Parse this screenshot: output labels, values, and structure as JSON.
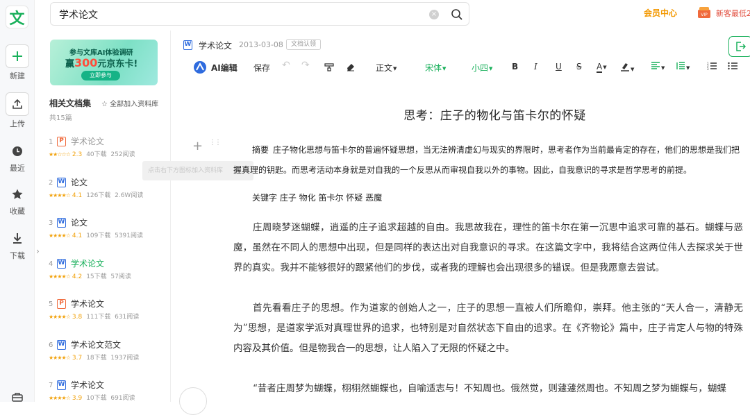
{
  "app": {
    "logo_char": "文"
  },
  "rail": {
    "new": "新建",
    "upload": "上传",
    "recent": "最近",
    "favorites": "收藏",
    "download": "下载"
  },
  "search": {
    "value": "学术论文"
  },
  "header": {
    "member_center": "会员中心",
    "newbie": "新客最低2"
  },
  "banner": {
    "line1": "参与文库AI体验调研",
    "line2_pre": "赢",
    "line2_num": "300",
    "line2_post": "元京东卡!",
    "button": "立即参与"
  },
  "related": {
    "title": "相关文档集",
    "add_all": "全部加入资料库",
    "count": "共15篇",
    "tooltip": "点击右下方图标加入资料库",
    "items": [
      {
        "num": "1",
        "type": "P",
        "name": "学术论文",
        "stars": "★★☆☆☆",
        "score": "2.3",
        "downloads": "40下载",
        "reads": "252阅读",
        "state": "gray"
      },
      {
        "num": "2",
        "type": "W",
        "name": "论文",
        "stars": "★★★★☆",
        "score": "4.1",
        "downloads": "126下载",
        "reads": "2.6W阅读",
        "state": "normal"
      },
      {
        "num": "3",
        "type": "W",
        "name": "论文",
        "stars": "★★★★☆",
        "score": "4.1",
        "downloads": "109下载",
        "reads": "5391阅读",
        "state": "normal"
      },
      {
        "num": "4",
        "type": "W",
        "name": "学术论文",
        "stars": "★★★★☆",
        "score": "4.2",
        "downloads": "15下载",
        "reads": "57阅读",
        "state": "active"
      },
      {
        "num": "5",
        "type": "P",
        "name": "学术论文",
        "stars": "★★★★☆",
        "score": "3.8",
        "downloads": "111下载",
        "reads": "631阅读",
        "state": "normal"
      },
      {
        "num": "6",
        "type": "W",
        "name": "学术论文范文",
        "stars": "★★★★☆",
        "score": "3.7",
        "downloads": "18下载",
        "reads": "1937阅读",
        "state": "normal"
      },
      {
        "num": "7",
        "type": "W",
        "name": "学术论文",
        "stars": "★★★★☆",
        "score": "3.9",
        "downloads": "10下载",
        "reads": "691阅读",
        "state": "normal"
      }
    ]
  },
  "doc": {
    "title": "学术论文",
    "date": "2013-03-08",
    "badge": "文档认领"
  },
  "toolbar": {
    "ai_edit": "AI编辑",
    "save": "保存",
    "style": "正文",
    "font": "宋体",
    "size": "小四"
  },
  "content": {
    "heading": "思考：庄子的物化与笛卡尔的怀疑",
    "abstract_label": "摘要",
    "abstract_text": "庄子物化思想与笛卡尔的普遍怀疑思想，当无法辨清虚幻与现实的界限时，思考者作为当前最肯定的存在，他们的思想是我们把握真理的钥匙。而思考活动本身就是对自我的一个反思从而审视自我以外的事物。因此，自我意识的寻求是哲学思考的前提。",
    "keywords": "关键字 庄子 物化 笛卡尔 怀疑 恶魔",
    "para1": "庄周晓梦迷蝴蝶，逍遥的庄子追求超越的自由。我思故我在，理性的笛卡尔在第一沉思中追求可靠的基石。蝴蝶与恶魔，虽然在不同人的思想中出现，但是同样的表达出对自我意识的寻求。在这篇文字中，我将结合这两位伟人去探求关于世界的真实。我并不能够很好的跟紧他们的步伐，或者我的理解也会出现很多的错误。但是我愿意去尝试。",
    "para2": "首先看看庄子的思想。作为道家的创始人之一，庄子的思想一直被人们所瞻仰，崇拜。他主张的“天人合一，清静无为”思想，是道家学派对真理世界的追求，也特别是对自然状态下自由的追求。在《齐物论》篇中，庄子肯定人与物的特殊内容及其价值。但是物我合一的思想，让人陷入了无限的怀疑之中。",
    "para3": "“昔者庄周梦为蝴蝶，栩栩然蝴蝶也，自喻适志与！不知周也。俄然觉，则蘧蘧然周也。不知周之梦为蝴蝶与，蝴蝶"
  },
  "colors": {
    "accent": "#19b05b",
    "member": "#f39800",
    "word_blue": "#2e6bde",
    "ppt_orange": "#f06a3c"
  }
}
